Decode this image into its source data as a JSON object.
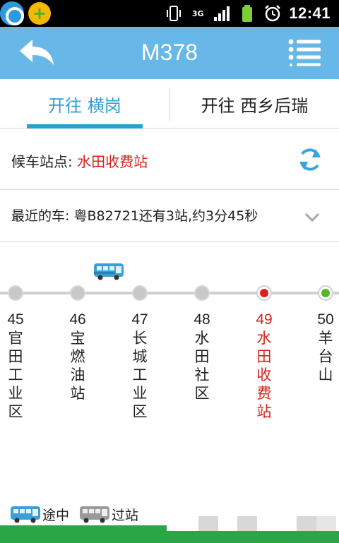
{
  "status_bar": {
    "network": "3G",
    "time": "12:41",
    "icons": [
      "qq-browser-icon",
      "app-plus-icon",
      "vibrate-icon",
      "signal-icon",
      "battery-icon",
      "alarm-icon"
    ]
  },
  "header": {
    "title": "M378",
    "back_icon": "back-arrow-icon",
    "menu_icon": "menu-list-icon"
  },
  "tabs": [
    {
      "label": "开往 横岗",
      "active": true
    },
    {
      "label": "开往 西乡后瑞",
      "active": false
    }
  ],
  "stop": {
    "label": "候车站点: ",
    "value": "水田收费站",
    "refresh_icon": "refresh-icon"
  },
  "latest": {
    "text": "最近的车: 粤B82721还有3站,约3分45秒",
    "expand_icon": "chevron-down-icon"
  },
  "stations": [
    {
      "number": "45",
      "name": "官田工业区",
      "state": "normal"
    },
    {
      "number": "46",
      "name": "宝燃油站",
      "state": "normal"
    },
    {
      "number": "47",
      "name": "长城工业区",
      "state": "normal"
    },
    {
      "number": "48",
      "name": "水田社区",
      "state": "normal"
    },
    {
      "number": "49",
      "name": "水田收费站",
      "state": "current"
    },
    {
      "number": "50",
      "name": "羊台山",
      "state": "next"
    }
  ],
  "legend": {
    "en_route": "途中",
    "passed": "过站"
  },
  "colors": {
    "header": "#67b8e8",
    "accent": "#2a9fd6",
    "highlight": "#d9201a",
    "next": "#58b52a"
  }
}
